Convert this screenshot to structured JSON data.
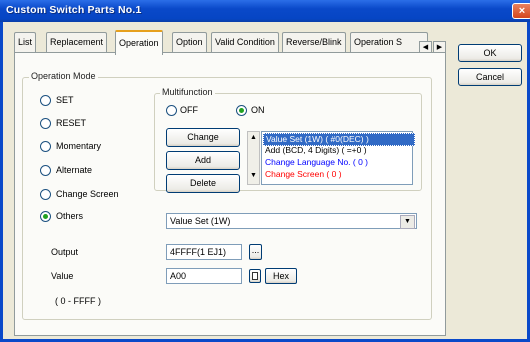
{
  "window": {
    "title": "Custom Switch Parts No.1",
    "close_glyph": "×"
  },
  "tabs": [
    "List",
    "Replacement",
    "Operation",
    "Option",
    "Valid Condition",
    "Reverse/Blink",
    "Operation S"
  ],
  "active_tab": "Operation",
  "tab_scroll": {
    "left": "◀",
    "right": "▶"
  },
  "dialog_buttons": {
    "ok": "OK",
    "cancel": "Cancel"
  },
  "operation_mode": {
    "legend": "Operation Mode",
    "options": [
      "SET",
      "RESET",
      "Momentary",
      "Alternate",
      "Change Screen",
      "Others"
    ],
    "selected": "Others"
  },
  "multifunction": {
    "legend": "Multifunction",
    "off_label": "OFF",
    "on_label": "ON",
    "selected": "ON",
    "buttons": {
      "change": "Change",
      "add": "Add",
      "delete": "Delete"
    },
    "list": [
      {
        "text": "Value Set (1W) ( #0(DEC) )",
        "color": "#0000ff",
        "selected": true
      },
      {
        "text": "Add (BCD, 4 Digits) ( =+0 )",
        "color": "#000000",
        "selected": false
      },
      {
        "text": "Change Language No. ( 0 )",
        "color": "#0000ff",
        "selected": false
      },
      {
        "text": "Change Screen ( 0 )",
        "color": "#ff0000",
        "selected": false
      }
    ],
    "spin_up": "▲",
    "spin_down": "▼"
  },
  "others_select": {
    "value": "Value Set (1W)",
    "arrow": "▼"
  },
  "output": {
    "label": "Output",
    "value": "4FFFF(1 EJ1)",
    "browse_label": "..."
  },
  "value_field": {
    "label": "Value",
    "value": "A00",
    "hex_button": "Hex"
  },
  "range_text": "( 0 - FFFF )",
  "colors": {
    "title_bar": "#0a49c9",
    "selection": "#316ac5",
    "active_tab_accent": "#e6a01d"
  }
}
